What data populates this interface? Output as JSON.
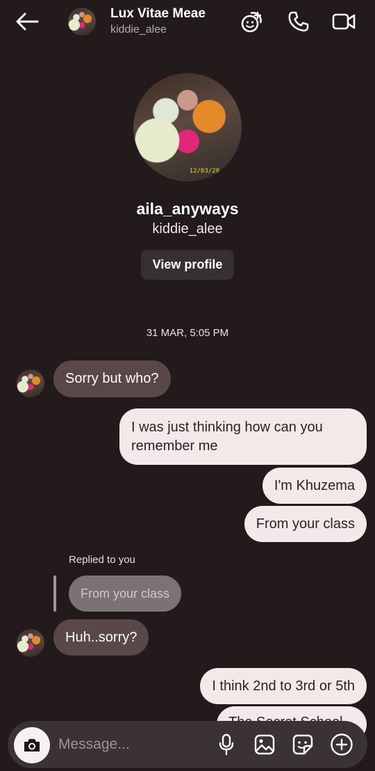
{
  "header": {
    "title": "Lux Vitae Meae",
    "subtitle": "kiddie_alee",
    "icons": [
      "back-arrow-icon",
      "effects-icon",
      "phone-icon",
      "video-camera-icon"
    ]
  },
  "profile": {
    "name": "aila_anyways",
    "handle": "kiddie_alee",
    "view_profile_label": "View profile",
    "photo_datestamp": "12/03/20"
  },
  "timestamp": "31 MAR, 5:05 PM",
  "messages": [
    {
      "side": "in",
      "text": "Sorry but who?"
    },
    {
      "side": "out",
      "text": "I was just thinking how can you remember me"
    },
    {
      "side": "out",
      "text": "I'm Khuzema"
    },
    {
      "side": "out",
      "text": "From your class"
    },
    {
      "side": "in",
      "text": "Huh..sorry?"
    },
    {
      "side": "out",
      "text": "I think 2nd to 3rd or 5th"
    },
    {
      "side": "out",
      "text": "The Secret School"
    }
  ],
  "reply": {
    "label": "Replied to you",
    "quote": "From your class"
  },
  "composer": {
    "placeholder": "Message...",
    "icons": [
      "camera-icon",
      "microphone-icon",
      "gallery-icon",
      "sticker-icon",
      "plus-icon"
    ]
  },
  "colors": {
    "background": "#221a1b",
    "incoming_bubble": "#5a4748",
    "outgoing_bubble": "#f5e8e9",
    "composer": "#3a3233"
  }
}
